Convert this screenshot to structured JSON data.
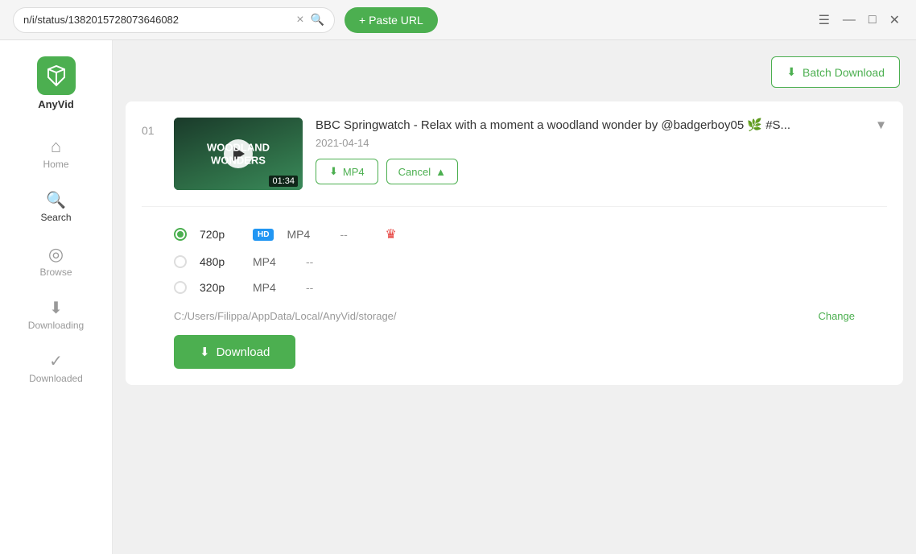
{
  "app": {
    "name": "AnyVid",
    "logo_alt": "AnyVid logo"
  },
  "titlebar": {
    "url_value": "n/i/status/1382015728073646082",
    "paste_url_label": "+ Paste URL",
    "clear_label": "×"
  },
  "window_controls": {
    "menu_icon": "☰",
    "minimize_icon": "—",
    "maximize_icon": "□",
    "close_icon": "✕"
  },
  "sidebar": {
    "items": [
      {
        "id": "home",
        "label": "Home",
        "icon": "⌂"
      },
      {
        "id": "search",
        "label": "Search",
        "icon": "🔍",
        "active": true
      },
      {
        "id": "browse",
        "label": "Browse",
        "icon": "◎"
      },
      {
        "id": "downloading",
        "label": "Downloading",
        "icon": "⬇"
      },
      {
        "id": "downloaded",
        "label": "Downloaded",
        "icon": "✓"
      }
    ]
  },
  "batch_download": {
    "label": "Batch Download",
    "icon": "⬇"
  },
  "video_card": {
    "number": "01",
    "title": "BBC Springwatch - Relax with a moment a woodland wonder by @badgerboy05 🌿 #S...",
    "date": "2021-04-14",
    "duration": "01:34",
    "thumb_text": "WOODLAND WONDERS",
    "mp4_button": "MP4",
    "cancel_button": "Cancel",
    "quality_options": [
      {
        "id": "720p",
        "label": "720p",
        "format": "MP4",
        "size": "--",
        "hd": true,
        "premium": true,
        "selected": true
      },
      {
        "id": "480p",
        "label": "480p",
        "format": "MP4",
        "size": "--",
        "hd": false,
        "premium": false,
        "selected": false
      },
      {
        "id": "320p",
        "label": "320p",
        "format": "MP4",
        "size": "--",
        "hd": false,
        "premium": false,
        "selected": false
      }
    ],
    "storage_path": "C:/Users/Filippa/AppData/Local/AnyVid/storage/",
    "change_label": "Change",
    "download_button": "Download"
  }
}
